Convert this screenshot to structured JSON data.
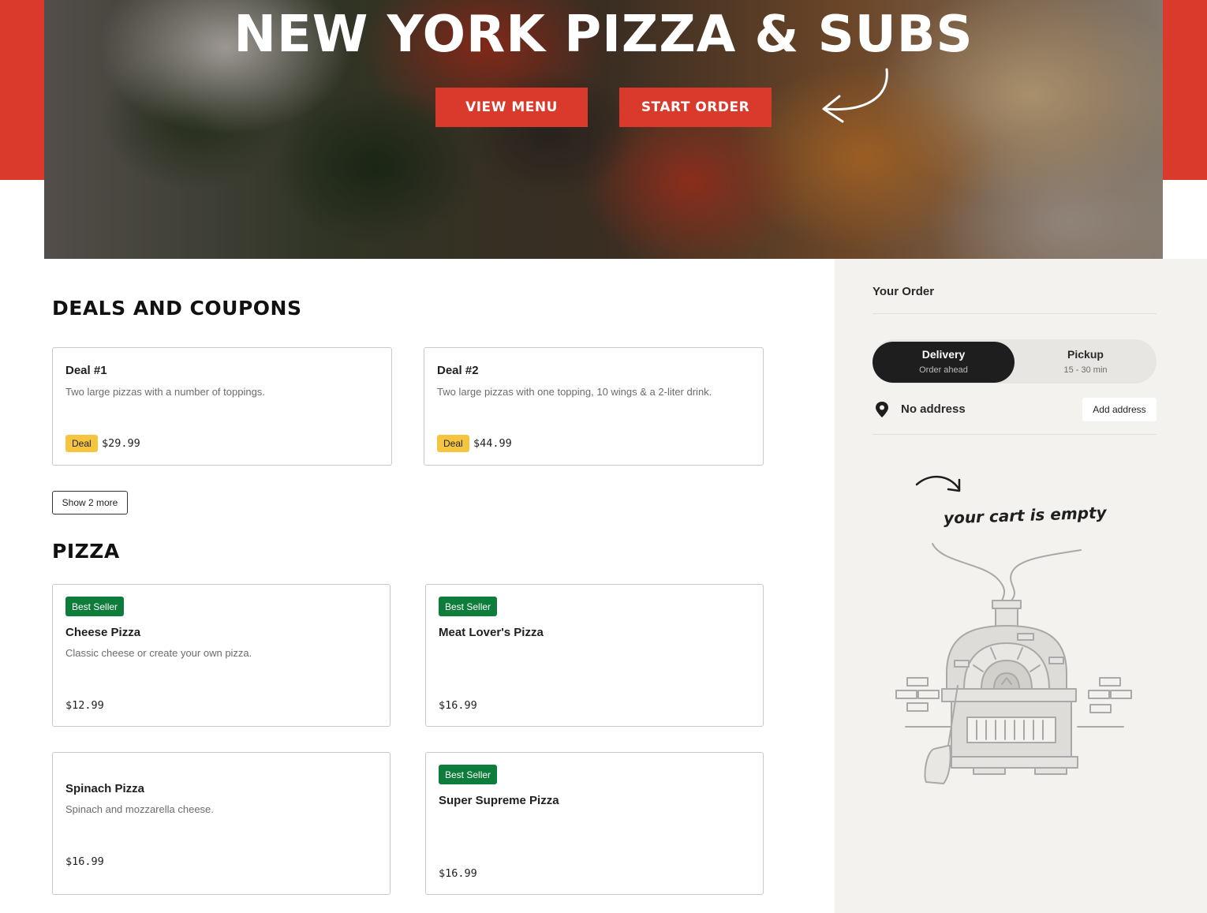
{
  "hero": {
    "title": "NEW YORK PIZZA & SUBS",
    "view_menu_label": "VIEW MENU",
    "start_order_label": "START ORDER"
  },
  "deals": {
    "title": "DEALS AND COUPONS",
    "items": [
      {
        "name": "Deal #1",
        "description": "Two large pizzas with a number of toppings.",
        "tag": "Deal",
        "price": "$29.99"
      },
      {
        "name": "Deal #2",
        "description": "Two large pizzas with one topping, 10 wings & a 2-liter drink.",
        "tag": "Deal",
        "price": "$44.99"
      }
    ],
    "show_more_label": "Show 2 more"
  },
  "pizza": {
    "title": "PIZZA",
    "items": [
      {
        "badge": "Best Seller",
        "name": "Cheese Pizza",
        "description": "Classic cheese or create your own pizza.",
        "price": "$12.99"
      },
      {
        "badge": "Best Seller",
        "name": "Meat Lover's Pizza",
        "description": "",
        "price": "$16.99"
      },
      {
        "badge": "",
        "name": "Spinach Pizza",
        "description": "Spinach and mozzarella cheese.",
        "price": "$16.99"
      },
      {
        "badge": "Best Seller",
        "name": "Super Supreme Pizza",
        "description": "",
        "price": "$16.99"
      }
    ]
  },
  "order": {
    "title": "Your Order",
    "delivery_label": "Delivery",
    "delivery_sub": "Order ahead",
    "pickup_label": "Pickup",
    "pickup_sub": "15 - 30 min",
    "address_text": "No address",
    "add_address_label": "Add address",
    "empty_cart_text": "your cart is empty"
  },
  "colors": {
    "brand_red": "#d93a2b",
    "deal_yellow": "#f6c540",
    "best_seller_green": "#0e7c3a",
    "sidebar_bg": "#f3f2ef"
  },
  "icons": {
    "arrow": "curved-arrow-icon",
    "pin": "location-pin-icon",
    "oven": "pizza-oven-illustration"
  }
}
